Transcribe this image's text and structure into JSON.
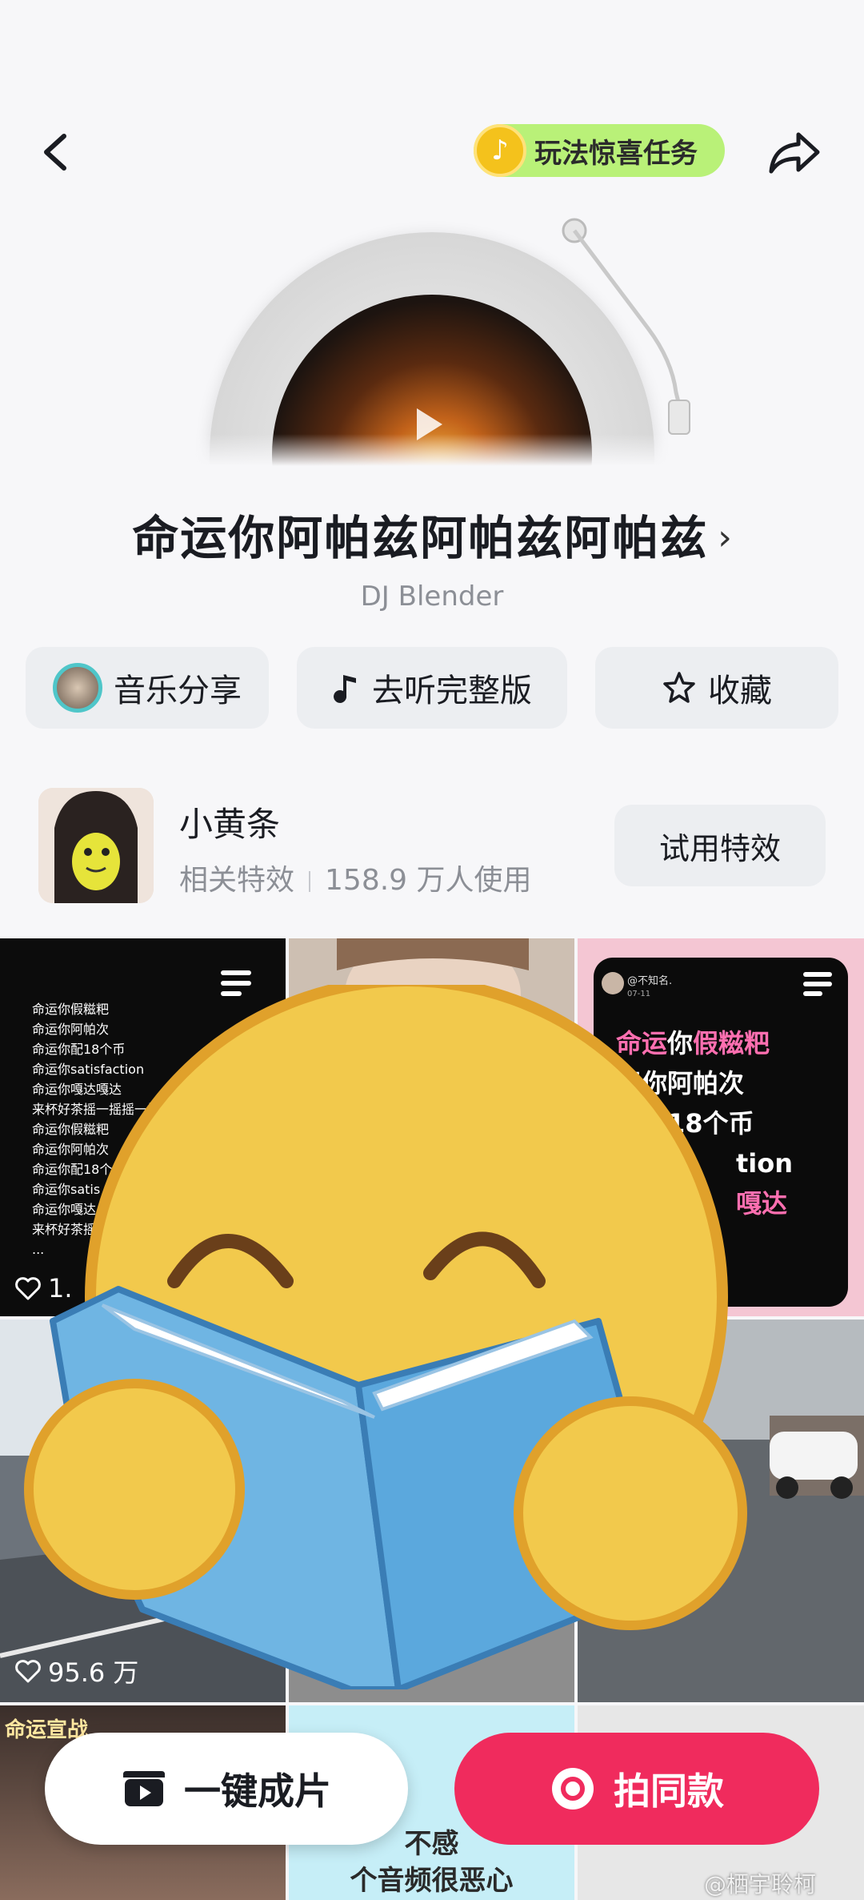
{
  "header": {
    "back_icon": "chevron-left-icon",
    "task_label": "玩法惊喜任务",
    "task_icon": "douyin-coin-icon",
    "share_icon": "share-arrow-icon"
  },
  "song": {
    "title": "命运你阿帕兹阿帕兹阿帕兹",
    "title_chevron": "›",
    "artist": "DJ Blender"
  },
  "actions": [
    {
      "label": "音乐分享",
      "icon": "avatar"
    },
    {
      "label": "去听完整版",
      "icon": "music-note-icon"
    },
    {
      "label": "收藏",
      "icon": "star-icon"
    }
  ],
  "effect": {
    "name": "小黄条",
    "meta_label": "相关特效",
    "usage": "158.9 万人使用",
    "try_label": "试用特效"
  },
  "grid": {
    "tile1": {
      "lyrics": [
        "命运你假糍粑",
        "命运你阿帕次",
        "命运你配18个币",
        "命运你satisfaction",
        "命运你嘎达嘎达",
        "来杯好茶摇一摇摇一摇",
        "命运你假糍粑",
        "命运你阿帕次",
        "命运你配18个",
        "命运你satis",
        "命运你嘎达",
        "来杯好茶摇",
        "..."
      ],
      "likes": "1."
    },
    "tile3": {
      "user": "@不知名.",
      "date": "07-11",
      "line1_pink": "命运",
      "line1_white": "你",
      "line1_pink2": "假糍粑",
      "line2": "运你阿帕次",
      "line3": "你配18个币",
      "line4": "tion",
      "line5": "嘎达"
    },
    "tile4": {
      "likes": "95.6 万"
    },
    "tile7": {
      "text": "命运宣战"
    },
    "tile8": {
      "line1": "不感",
      "line2": "个音频很恶心"
    }
  },
  "bottom": {
    "left_label": "一键成片",
    "left_icon": "clapperboard-icon",
    "right_label": "拍同款",
    "right_icon": "camera-icon"
  },
  "watermark": "@栖宇聆柯",
  "colors": {
    "accent_red": "#f02b5d",
    "task_green": "#b9f178",
    "coin_gold": "#f4c21c",
    "pink_highlight": "#ff6fb0"
  }
}
